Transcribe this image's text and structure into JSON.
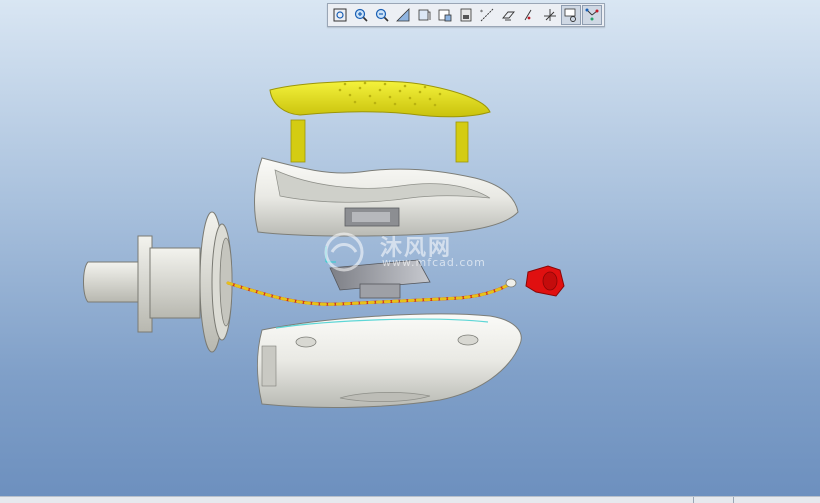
{
  "toolbar": {
    "buttons": [
      {
        "icon": "refit-icon"
      },
      {
        "icon": "zoom-in-icon"
      },
      {
        "icon": "zoom-out-icon"
      },
      {
        "icon": "reorient-icon"
      },
      {
        "icon": "saved-views-icon"
      },
      {
        "icon": "display-style-icon"
      },
      {
        "icon": "layers-icon"
      },
      {
        "icon": "datum-axes-icon"
      },
      {
        "icon": "datum-planes-icon"
      },
      {
        "icon": "datum-points-icon"
      },
      {
        "icon": "coordinate-systems-icon"
      },
      {
        "icon": "annotations-icon"
      },
      {
        "icon": "spin-center-icon"
      }
    ]
  },
  "watermark": {
    "title": "沐风网",
    "url": "www.mfcad.com"
  },
  "colors": {
    "handle": "#e6e21a",
    "body": "#e9e9e4",
    "red_part": "#e01010",
    "wire_red": "#d02a1a",
    "wire_yellow": "#e6c21a",
    "background_top": "#d9e6f3",
    "background_bottom": "#6c8fbe"
  }
}
